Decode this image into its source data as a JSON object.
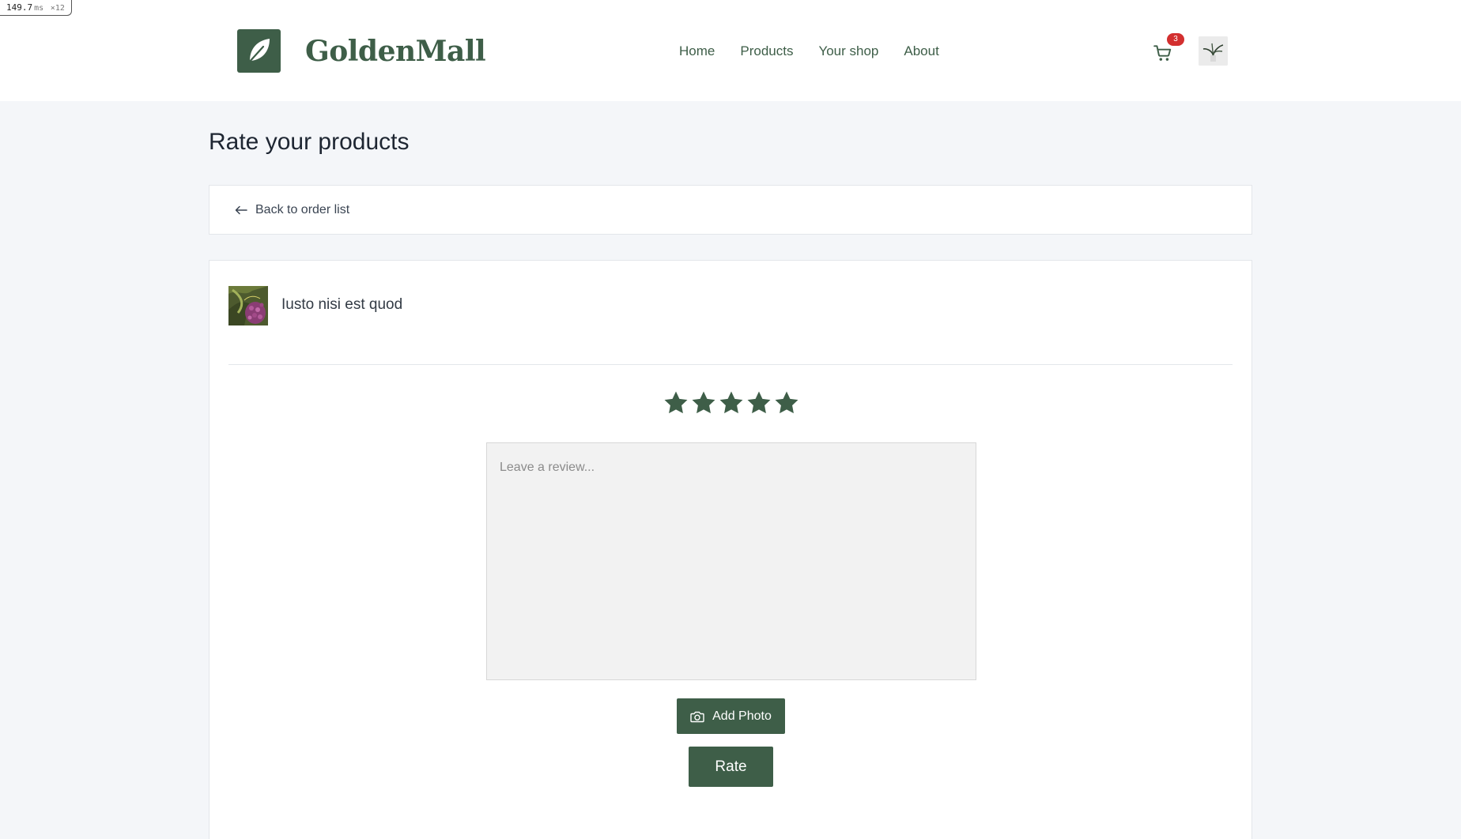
{
  "perf": {
    "value": "149.7",
    "unit": "ms",
    "multiplier": "×12"
  },
  "header": {
    "brand": "GoldenMall",
    "nav": [
      "Home",
      "Products",
      "Your shop",
      "About"
    ],
    "cart_count": "3",
    "logo_icon": "leaf-icon",
    "cart_icon": "cart-icon"
  },
  "page": {
    "title": "Rate your products"
  },
  "back": {
    "label": "Back to order list",
    "icon": "arrow-left-icon"
  },
  "product": {
    "name": "Iusto nisi est quod",
    "rating": 5,
    "max_rating": 5
  },
  "review": {
    "placeholder": "Leave a review..."
  },
  "actions": {
    "add_photo": "Add Photo",
    "rate": "Rate"
  },
  "colors": {
    "brand": "#3e5e48",
    "badge": "#d32f2f",
    "background": "#f4f6f9"
  }
}
